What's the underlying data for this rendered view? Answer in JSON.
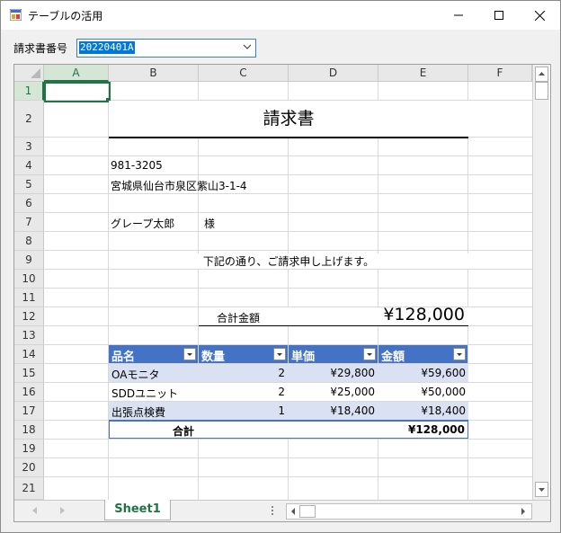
{
  "window": {
    "title": "テーブルの活用"
  },
  "form": {
    "invoice_label": "請求書番号",
    "invoice_value": "20220401A"
  },
  "columns": [
    "A",
    "B",
    "C",
    "D",
    "E",
    "F"
  ],
  "rows": [
    "1",
    "2",
    "3",
    "4",
    "5",
    "6",
    "7",
    "8",
    "9",
    "10",
    "11",
    "12",
    "13",
    "14",
    "15",
    "16",
    "17",
    "18",
    "19",
    "20",
    "21"
  ],
  "invoice": {
    "title": "請求書",
    "postal": "981-3205",
    "address": "宮城県仙台市泉区紫山3-1-4",
    "customer": "グレープ太郎",
    "honorific": "様",
    "message": "下記の通り、ご請求申し上げます。",
    "total_label": "合計金額",
    "total_value": "¥128,000"
  },
  "table": {
    "headers": [
      "品名",
      "数量",
      "単価",
      "金額"
    ],
    "rows": [
      {
        "name": "OAモニタ",
        "qty": "2",
        "price": "¥29,800",
        "amount": "¥59,600"
      },
      {
        "name": "SDDユニット",
        "qty": "2",
        "price": "¥25,000",
        "amount": "¥50,000"
      },
      {
        "name": "出張点検費",
        "qty": "1",
        "price": "¥18,400",
        "amount": "¥18,400"
      }
    ],
    "total_label": "合計",
    "total_value": "¥128,000"
  },
  "sheet_tab": "Sheet1",
  "colors": {
    "header_blue": "#4472c4",
    "band_light": "#d9e1f2",
    "excel_green": "#217346",
    "selection_highlight": "#0078d7"
  }
}
